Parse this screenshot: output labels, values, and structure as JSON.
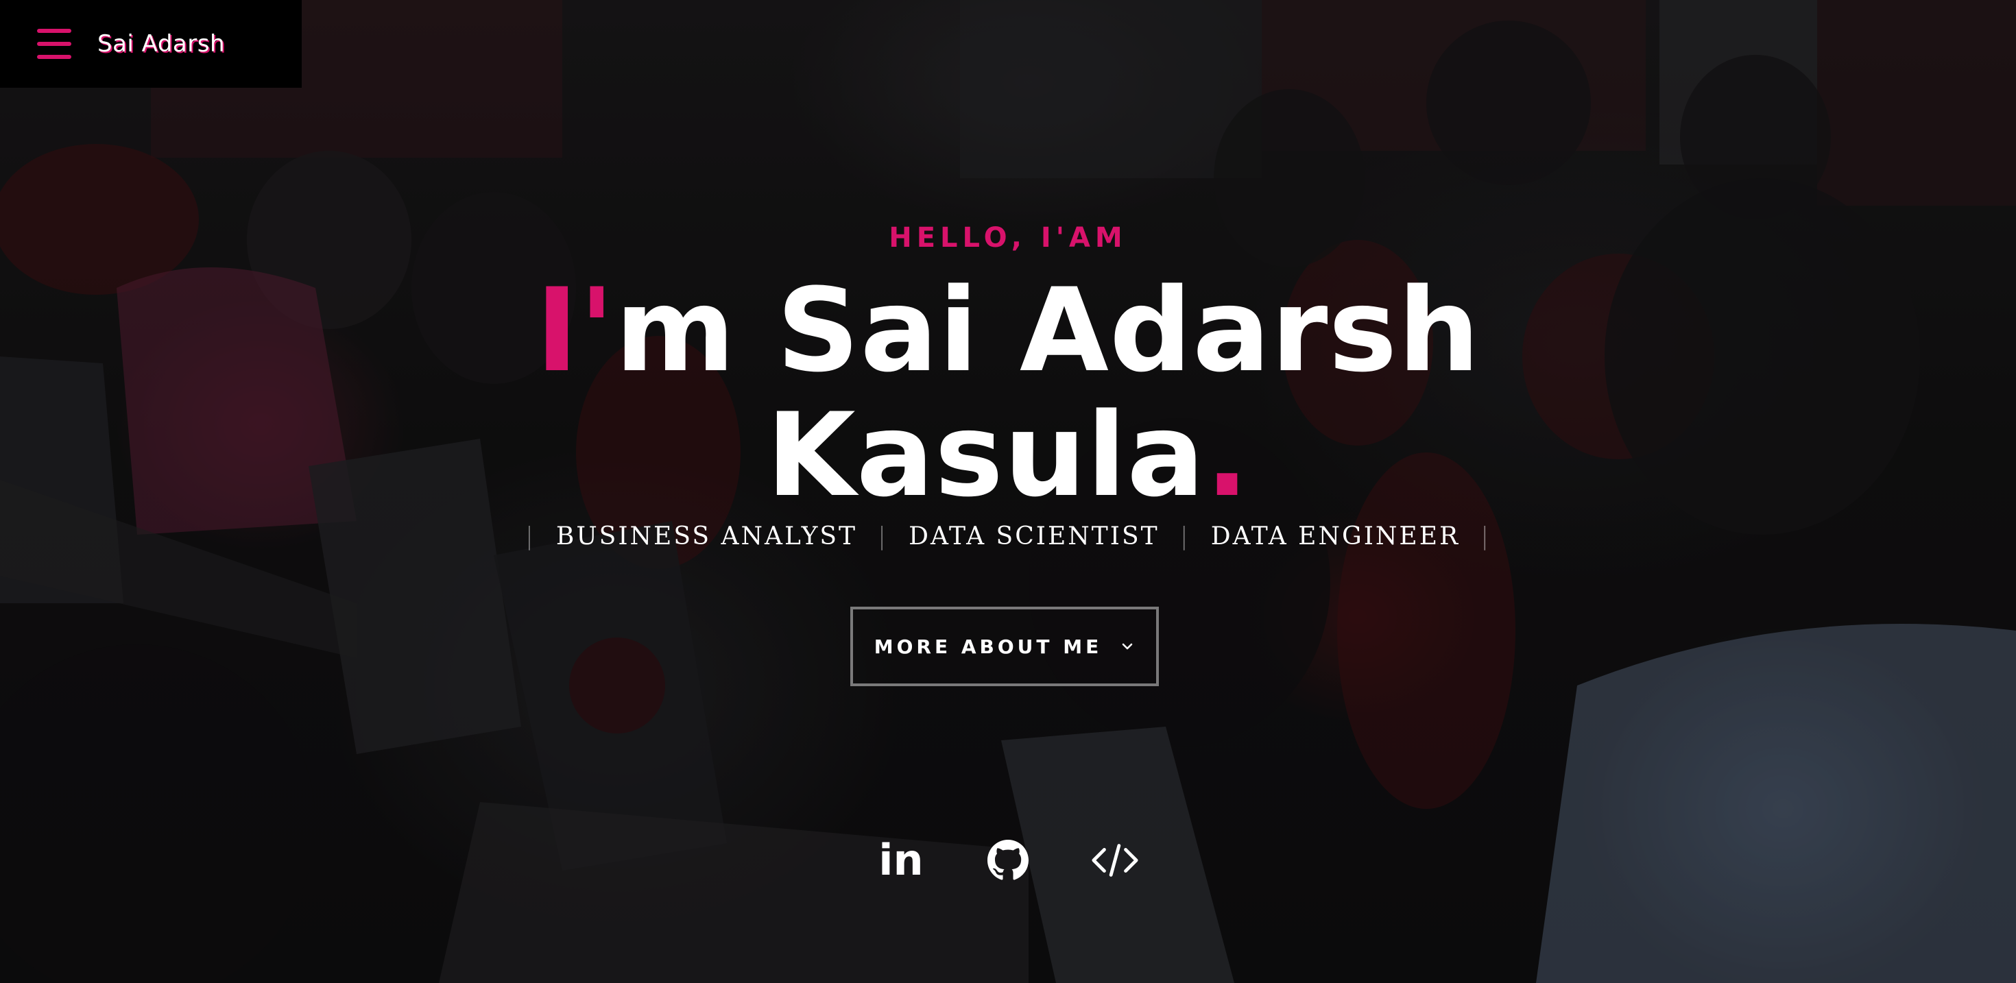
{
  "header": {
    "brand_name": "Sai Adarsh",
    "menu_icon": "hamburger-menu-icon"
  },
  "hero": {
    "greeting": "HELLO, I'AM",
    "name_line_1_accent": "I'",
    "name_line_1_rest": "m Sai Adarsh",
    "name_line_2": "Kasula",
    "name_line_2_accent": ".",
    "roles": [
      "BUSINESS ANALYST",
      "DATA SCIENTIST",
      "DATA ENGINEER"
    ],
    "role_separator": "|",
    "more_button_label": "MORE ABOUT ME"
  },
  "socials": {
    "linkedin_label": "in",
    "linkedin_icon": "linkedin-icon",
    "github_icon": "github-icon",
    "code_icon": "code-icon"
  },
  "colors": {
    "accent": "#d8126b",
    "text": "#ffffff",
    "header_bg": "#000000"
  }
}
